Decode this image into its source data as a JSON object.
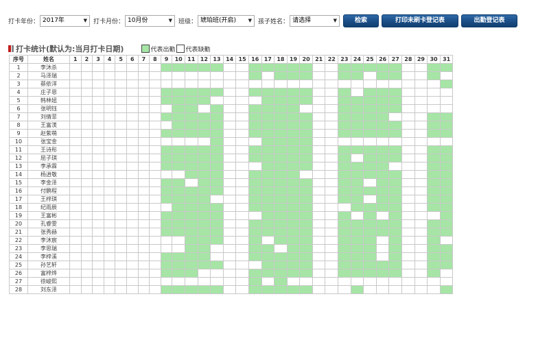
{
  "toolbar": {
    "year_label": "打卡年份：",
    "year_value": "2017年",
    "month_label": "打卡月份：",
    "month_value": "10月份",
    "class_label": "班级：",
    "class_value": "琥珀班(开启)",
    "child_label": "孩子姓名：",
    "child_value": "请选择",
    "search_button": "检索",
    "print_button": "打印未刷卡登记表",
    "attendance_button": "出勤登记表"
  },
  "heading": {
    "title": "打卡统计(默认为:当月打卡日期)",
    "legend_present": "代表出勤",
    "legend_absent": "代表缺勤"
  },
  "colors": {
    "present": "#a6e5a6",
    "absent": "#ffffff",
    "button": "#1a4d85",
    "title_marker": "#c21b1b"
  },
  "table": {
    "headers": [
      "序号",
      "姓名",
      "1",
      "2",
      "3",
      "4",
      "5",
      "6",
      "7",
      "8",
      "9",
      "10",
      "11",
      "12",
      "13",
      "14",
      "15",
      "16",
      "17",
      "18",
      "19",
      "20",
      "21",
      "22",
      "23",
      "24",
      "25",
      "26",
      "27",
      "28",
      "29",
      "30",
      "31"
    ],
    "rows": [
      {
        "no": "1",
        "name": "李沐杀",
        "days": [
          9,
          10,
          11,
          12,
          13,
          16,
          17,
          18,
          19,
          20,
          23,
          24,
          25,
          26,
          27,
          30,
          31
        ]
      },
      {
        "no": "2",
        "name": "马泽瑞",
        "days": [
          16,
          18,
          19,
          20,
          23,
          24,
          26,
          27,
          30
        ]
      },
      {
        "no": "3",
        "name": "蔡依洋",
        "days": [
          31
        ]
      },
      {
        "no": "4",
        "name": "庄子恩",
        "days": [
          9,
          10,
          11,
          12,
          13,
          16,
          17,
          18,
          19,
          20,
          23,
          25,
          26,
          27
        ]
      },
      {
        "no": "5",
        "name": "韩林妞",
        "days": [
          9,
          10,
          11,
          12,
          17,
          18,
          19,
          20,
          23,
          24,
          25,
          26,
          27
        ]
      },
      {
        "no": "6",
        "name": "张明钰",
        "days": [
          10,
          11,
          13,
          16,
          17,
          18,
          19,
          23,
          24,
          25,
          26,
          27
        ]
      },
      {
        "no": "7",
        "name": "刘倩菲",
        "days": [
          9,
          10,
          11,
          12,
          13,
          16,
          17,
          18,
          19,
          20,
          23,
          24,
          25,
          26,
          30,
          31
        ]
      },
      {
        "no": "8",
        "name": "王富渼",
        "days": [
          10,
          11,
          12,
          13,
          16,
          17,
          18,
          19,
          20,
          23,
          24,
          25,
          26,
          27,
          30,
          31
        ]
      },
      {
        "no": "9",
        "name": "赵紫萌",
        "days": [
          9,
          10,
          11,
          12,
          13,
          16,
          17,
          18,
          19,
          20,
          23,
          24,
          25,
          26,
          27,
          30,
          31
        ]
      },
      {
        "no": "10",
        "name": "张宝金",
        "days": [
          13,
          17,
          18,
          19,
          20
        ]
      },
      {
        "no": "11",
        "name": "王诗彤",
        "days": [
          9,
          10,
          11,
          12,
          13,
          16,
          17,
          18,
          19,
          20,
          23,
          24,
          25,
          26,
          27,
          30,
          31
        ]
      },
      {
        "no": "12",
        "name": "屈子琪",
        "days": [
          9,
          10,
          11,
          12,
          13,
          16,
          17,
          18,
          19,
          20,
          23,
          25,
          26,
          27,
          30,
          31
        ]
      },
      {
        "no": "13",
        "name": "李承霖",
        "days": [
          9,
          10,
          11,
          12,
          13,
          17,
          18,
          19,
          20,
          23,
          24,
          25,
          26,
          30,
          31
        ]
      },
      {
        "no": "14",
        "name": "杨逍敬",
        "days": [
          11,
          12,
          13,
          16,
          17,
          18,
          19,
          23,
          24,
          25,
          26,
          27,
          30,
          31
        ]
      },
      {
        "no": "15",
        "name": "李金泽",
        "days": [
          9,
          10,
          12,
          13,
          16,
          17,
          18,
          19,
          20,
          23,
          24,
          26,
          27,
          30,
          31
        ]
      },
      {
        "no": "16",
        "name": "付鹏程",
        "days": [
          9,
          10,
          11,
          12,
          13,
          16,
          17,
          18,
          19,
          20,
          23,
          24,
          25,
          26,
          27,
          30,
          31
        ]
      },
      {
        "no": "17",
        "name": "王梓琪",
        "days": [
          9,
          10,
          11,
          12,
          16,
          17,
          18,
          19,
          20,
          23,
          24,
          26,
          27,
          30,
          31
        ]
      },
      {
        "no": "18",
        "name": "纪雨辰",
        "days": [
          10,
          11,
          12,
          13,
          16,
          17,
          18,
          19,
          20,
          24,
          25,
          26,
          27,
          30,
          31
        ]
      },
      {
        "no": "19",
        "name": "王富彬",
        "days": [
          9,
          10,
          11,
          12,
          13,
          17,
          18,
          19,
          20,
          23,
          25,
          27,
          31
        ]
      },
      {
        "no": "20",
        "name": "孔睿雯",
        "days": [
          9,
          10,
          11,
          12,
          13,
          16,
          17,
          18,
          19,
          20,
          23,
          24,
          25,
          26,
          27,
          30,
          31
        ]
      },
      {
        "no": "21",
        "name": "张秀赫",
        "days": [
          9,
          10,
          11,
          12,
          13,
          16,
          17,
          18,
          19,
          20,
          23,
          24,
          25,
          26,
          27,
          30,
          31
        ]
      },
      {
        "no": "22",
        "name": "李沐宸",
        "days": [
          11,
          12,
          13,
          16,
          18,
          19,
          20,
          23,
          24,
          25,
          27,
          30
        ]
      },
      {
        "no": "23",
        "name": "李思瑞",
        "days": [
          11,
          12,
          16,
          17,
          19,
          20,
          23,
          24,
          25,
          27,
          30,
          31
        ]
      },
      {
        "no": "24",
        "name": "李梓溪",
        "days": [
          9,
          10,
          11,
          12,
          16,
          17,
          18,
          19,
          20,
          23,
          24,
          25,
          27,
          30,
          31
        ]
      },
      {
        "no": "25",
        "name": "孙艺轩",
        "days": [
          9,
          10,
          11,
          12,
          13,
          17,
          18,
          19,
          20,
          23,
          24,
          25,
          26,
          27,
          30,
          31
        ]
      },
      {
        "no": "26",
        "name": "富梓烨",
        "days": [
          9,
          10,
          11,
          16,
          17,
          18,
          19,
          20,
          23,
          24,
          25,
          26,
          27,
          30
        ]
      },
      {
        "no": "27",
        "name": "徐峻熙",
        "days": [
          16,
          18
        ]
      },
      {
        "no": "28",
        "name": "刘东泽",
        "days": [
          9,
          10,
          11,
          12,
          13,
          16,
          17,
          18,
          19,
          20,
          24,
          31
        ]
      }
    ]
  }
}
